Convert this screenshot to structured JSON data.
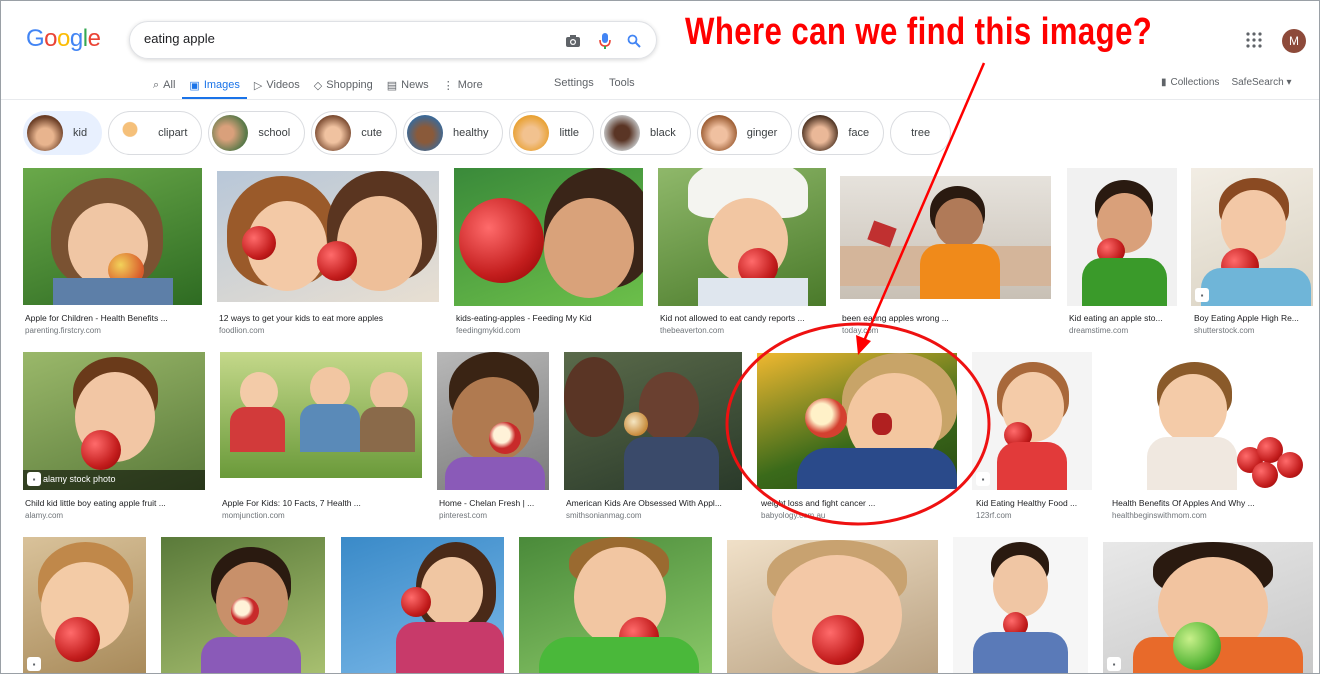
{
  "logo": [
    "G",
    "o",
    "o",
    "g",
    "l",
    "e"
  ],
  "search": {
    "value": "eating apple"
  },
  "tabs": [
    {
      "label": "All",
      "icon": "search-icon"
    },
    {
      "label": "Images",
      "icon": "image-icon"
    },
    {
      "label": "Videos",
      "icon": "video-icon"
    },
    {
      "label": "Shopping",
      "icon": "tag-icon"
    },
    {
      "label": "News",
      "icon": "news-icon"
    },
    {
      "label": "More",
      "icon": "more-vert-icon"
    }
  ],
  "settings_label": "Settings",
  "tools_label": "Tools",
  "collections_label": "Collections",
  "safesearch_label": "SafeSearch ▾",
  "avatar_letter": "M",
  "annotation": "Where can we find this image?",
  "chips": [
    "kid",
    "clipart",
    "school",
    "cute",
    "healthy",
    "little",
    "black",
    "ginger",
    "face",
    "tree"
  ],
  "row1": [
    {
      "caption": "Apple for Children - Health Benefits ...",
      "source": "parenting.firstcry.com"
    },
    {
      "caption": "12 ways to get your kids to eat more apples",
      "source": "foodlion.com"
    },
    {
      "caption": "kids-eating-apples - Feeding My Kid",
      "source": "feedingmykid.com"
    },
    {
      "caption": "Kid not allowed to eat candy reports ...",
      "source": "thebeaverton.com"
    },
    {
      "caption": "been eating apples wrong ...",
      "source": "today.com"
    },
    {
      "caption": "Kid eating an apple sto...",
      "source": "dreamstime.com"
    },
    {
      "caption": "Boy Eating Apple High Re...",
      "source": "shutterstock.com"
    }
  ],
  "row2": [
    {
      "caption": "Child kid little boy eating apple fruit ...",
      "source": "alamy.com",
      "overlay": "alamy stock photo"
    },
    {
      "caption": "Apple For Kids: 10 Facts, 7 Health ...",
      "source": "momjunction.com"
    },
    {
      "caption": "Home - Chelan Fresh | ...",
      "source": "pinterest.com"
    },
    {
      "caption": "American Kids Are Obsessed With Appl...",
      "source": "smithsonianmag.com"
    },
    {
      "caption": "weight loss and fight cancer ...",
      "source": "babyology.com.au"
    },
    {
      "caption": "Kid Eating Healthy Food ...",
      "source": "123rf.com"
    },
    {
      "caption": "Health Benefits Of Apples And Why ...",
      "source": "healthbeginswithmom.com"
    }
  ],
  "colors": {
    "annotation": "#ff0000",
    "accent": "#1a73e8"
  }
}
